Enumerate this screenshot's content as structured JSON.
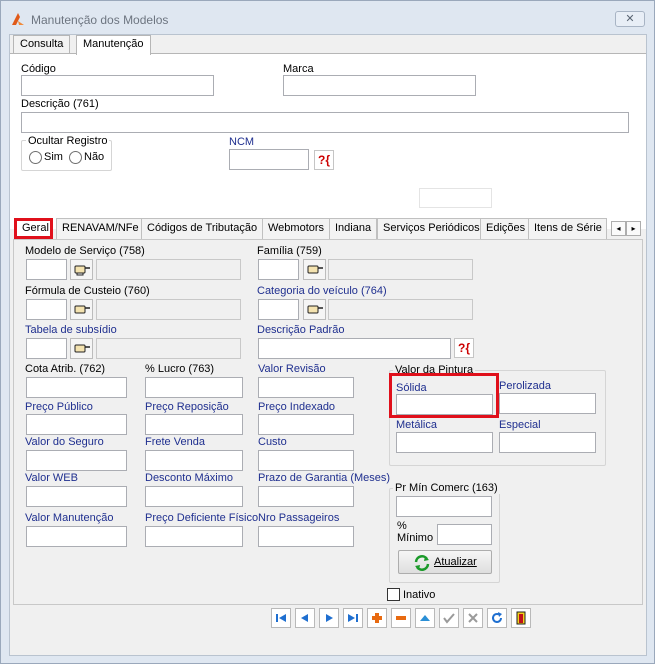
{
  "window": {
    "title": "Manutenção dos Modelos",
    "close_glyph": "✕"
  },
  "top_tabs": [
    "Consulta",
    "Manutenção"
  ],
  "header": {
    "codigo_label": "Código",
    "marca_label": "Marca",
    "descricao_label": "Descrição (761)",
    "ocultar_label": "Ocultar Registro",
    "sim_label": "Sim",
    "nao_label": "Não",
    "ncm_label": "NCM",
    "question_glyph": "?{"
  },
  "inner_tabs": [
    "Geral",
    "RENAVAM/NFe",
    "Códigos de Tributação",
    "Webmotors",
    "Indiana",
    "Serviços Periódicos",
    "Edições",
    "Itens de Série"
  ],
  "tab_scroll": {
    "left": "◂",
    "right": "▸"
  },
  "geral": {
    "modelo_servico": "Modelo de Serviço (758)",
    "familia": "Família (759)",
    "formula_custeio": "Fórmula de Custeio (760)",
    "categoria_veiculo": "Categoria do veículo (764)",
    "tabela_subsidio": "Tabela de subsídio",
    "descricao_padrao": "Descrição Padrão",
    "cota_atrib": "Cota Atrib. (762)",
    "pct_lucro": "% Lucro (763)",
    "valor_revisao": "Valor Revisão",
    "preco_publico": "Preço Público",
    "preco_reposicao": "Preço Reposição",
    "preco_indexado": "Preço Indexado",
    "valor_seguro": "Valor do Seguro",
    "frete_venda": "Frete Venda",
    "custo": "Custo",
    "valor_web": "Valor WEB",
    "desconto_maximo": "Desconto Máximo",
    "prazo_garantia": "Prazo de Garantia (Meses)",
    "valor_manutencao": "Valor Manutenção",
    "preco_deficiente": "Preço Deficiente Físico",
    "nro_passageiros": "Nro Passageiros"
  },
  "pintura": {
    "title": "Valor da Pintura",
    "solida": "Sólida",
    "perolizada": "Perolizada",
    "metalica": "Metálica",
    "especial": "Especial"
  },
  "pr_min": {
    "title": "Pr Mín Comerc (163)",
    "pct": "%",
    "minimo": "Mínimo",
    "atualizar": "Atualizar"
  },
  "inativo_label": "Inativo",
  "colors": {
    "highlight": "#e0101b",
    "blue_label": "#1f2f8f",
    "nav_blue": "#1f6fd0"
  }
}
